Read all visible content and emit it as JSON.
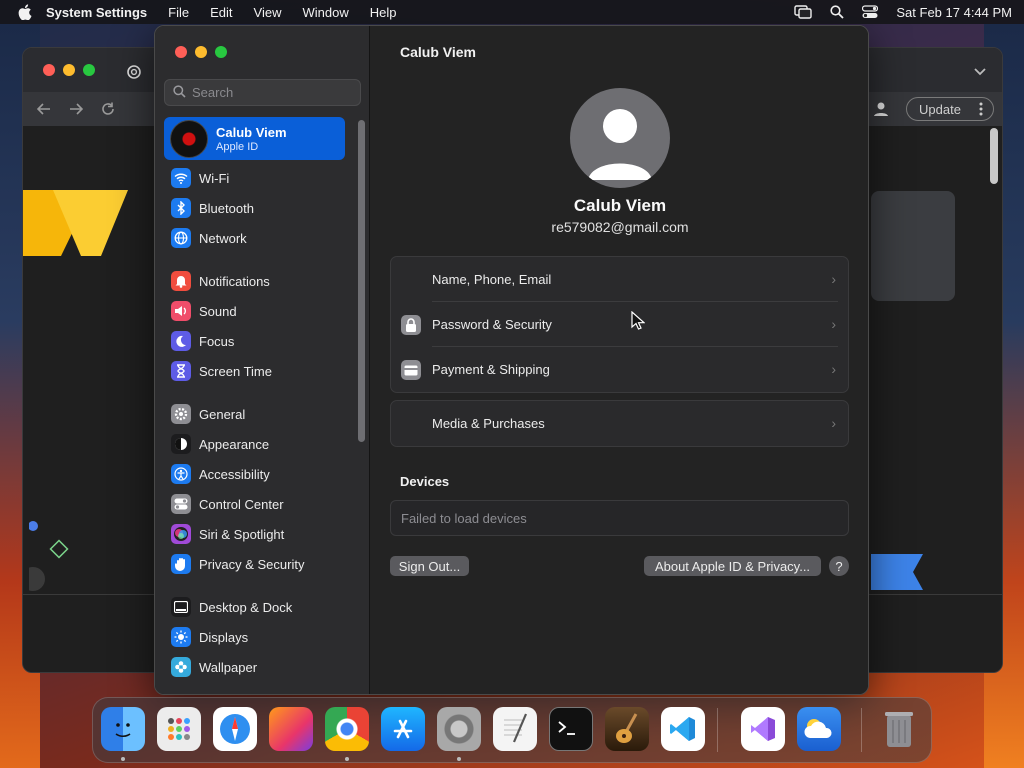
{
  "menubar": {
    "app_name": "System Settings",
    "items": [
      "File",
      "Edit",
      "View",
      "Window",
      "Help"
    ],
    "clock": "Sat Feb 17  4:44 PM"
  },
  "chrome": {
    "update_label": "Update"
  },
  "sidebar": {
    "search_placeholder": "Search",
    "account": {
      "name": "Calub Viem",
      "subtitle": "Apple ID"
    },
    "items": [
      {
        "label": "Wi-Fi",
        "icon": "wifi-icon",
        "color": "#1d7bf0"
      },
      {
        "label": "Bluetooth",
        "icon": "bluetooth-icon",
        "color": "#1d7bf0"
      },
      {
        "label": "Network",
        "icon": "globe-icon",
        "color": "#1d7bf0"
      },
      {
        "label": "Notifications",
        "icon": "bell-icon",
        "color": "#f04d3e"
      },
      {
        "label": "Sound",
        "icon": "speaker-icon",
        "color": "#f04d6a"
      },
      {
        "label": "Focus",
        "icon": "moon-icon",
        "color": "#5e5ce6"
      },
      {
        "label": "Screen Time",
        "icon": "hourglass-icon",
        "color": "#5e5ce6"
      },
      {
        "label": "General",
        "icon": "gear-icon",
        "color": "#8e8e93"
      },
      {
        "label": "Appearance",
        "icon": "appearance-icon",
        "color": "#1c1c1e"
      },
      {
        "label": "Accessibility",
        "icon": "accessibility-icon",
        "color": "#1d7bf0"
      },
      {
        "label": "Control Center",
        "icon": "toggles-icon",
        "color": "#8e8e93"
      },
      {
        "label": "Siri & Spotlight",
        "icon": "siri-icon",
        "color": "#a04ad8"
      },
      {
        "label": "Privacy & Security",
        "icon": "hand-icon",
        "color": "#1d7bf0"
      },
      {
        "label": "Desktop & Dock",
        "icon": "dock-icon",
        "color": "#1c1c1e"
      },
      {
        "label": "Displays",
        "icon": "sun-icon",
        "color": "#1d7bf0"
      },
      {
        "label": "Wallpaper",
        "icon": "flower-icon",
        "color": "#35aadc"
      }
    ]
  },
  "main": {
    "title": "Calub Viem",
    "profile_name": "Calub Viem",
    "profile_email": "re579082@gmail.com",
    "group1": [
      {
        "label": "Name, Phone, Email",
        "icon": ""
      },
      {
        "label": "Password & Security",
        "icon": "lock-icon"
      },
      {
        "label": "Payment & Shipping",
        "icon": "card-icon"
      }
    ],
    "group2": [
      {
        "label": "Media & Purchases",
        "icon": ""
      }
    ],
    "devices_title": "Devices",
    "devices_status": "Failed to load devices",
    "sign_out_label": "Sign Out...",
    "about_label": "About Apple ID & Privacy...",
    "help_label": "?"
  },
  "dock": {
    "apps": [
      "Finder",
      "Launchpad",
      "Safari",
      "Firefox",
      "Chrome",
      "App Store",
      "System Settings",
      "TextEdit",
      "Terminal",
      "GarageBand",
      "Visual Studio Code",
      "Visual Studio",
      "Weather",
      "Trash"
    ]
  }
}
